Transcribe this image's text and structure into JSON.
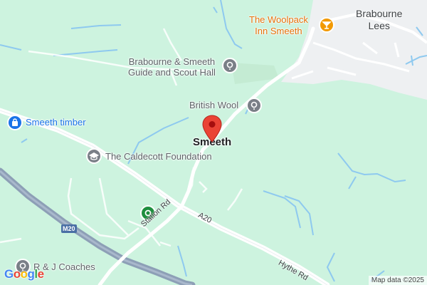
{
  "map": {
    "places": {
      "center": "Smeeth",
      "town": "Brabourne\nLees"
    },
    "pois": {
      "scout_hall": "Brabourne & Smeeth\nGuide and Scout Hall",
      "british_wool": "British Wool",
      "smeeth_timber": "Smeeth timber",
      "caldecott": "The Caldecott Foundation",
      "woolpack": "The Woolpack\nInn Smeeth",
      "coaches": "R & J Coaches"
    },
    "roads": {
      "a20": "A20",
      "station_rd": "Station Rd",
      "hythe_rd": "Hythe Rd",
      "m20": "M20"
    },
    "attribution": "Map data ©2025",
    "logo": "Google",
    "colors": {
      "land": "#cdf3df",
      "urban": "#eef0f2",
      "water": "#8ec9ef",
      "motorway": "#8d9fb6",
      "road": "#ffffff",
      "pin": "#ea4335",
      "poi_blue": "#1a73e8",
      "poi_gray": "#7a7f87",
      "poi_green": "#1e8e3e",
      "poi_orange": "#f29900"
    },
    "icons": {
      "scout_hall": "pin-icon",
      "british_wool": "pin-icon",
      "smeeth_timber": "shopping-bag-icon",
      "caldecott": "graduation-cap-icon",
      "woolpack": "cocktail-glass-icon",
      "coaches": "pin-icon",
      "green_poi": "place-icon",
      "marker": "location-marker-icon"
    }
  }
}
